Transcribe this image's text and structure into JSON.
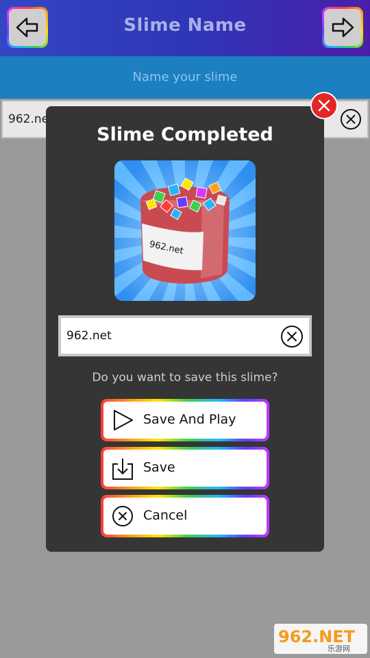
{
  "header": {
    "title": "Slime Name",
    "back_icon": "arrow-left-icon",
    "forward_icon": "arrow-right-icon"
  },
  "subheader": {
    "text": "Name your slime"
  },
  "background_input": {
    "value": "962.ne"
  },
  "modal": {
    "title": "Slime Completed",
    "preview_label": "962.net",
    "name_input": {
      "value": "962.net"
    },
    "question": "Do you want to save this slime?",
    "buttons": [
      {
        "label": "Save And Play",
        "icon": "play-icon"
      },
      {
        "label": "Save",
        "icon": "download-icon"
      },
      {
        "label": "Cancel",
        "icon": "cancel-circle-icon"
      }
    ]
  },
  "watermark": {
    "text": "962.NET",
    "subtext": "乐游网"
  },
  "colors": {
    "header_blue": "#3346c4",
    "subheader_blue": "#1c7fc0",
    "modal_bg": "#353535",
    "close_red": "#e32626"
  }
}
